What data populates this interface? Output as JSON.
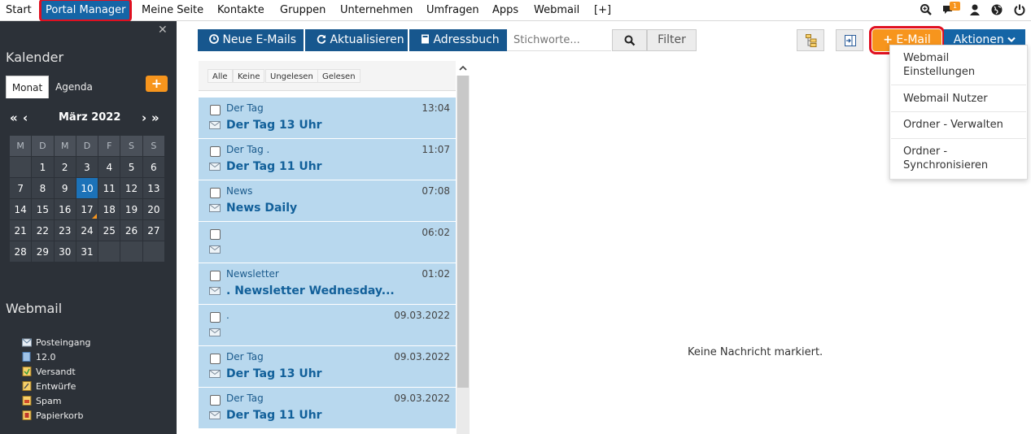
{
  "nav": {
    "items": [
      "Start",
      "Portal Manager",
      "Meine Seite",
      "Kontakte",
      "Gruppen",
      "Unternehmen",
      "Umfragen",
      "Apps",
      "Webmail",
      "[+]"
    ],
    "notification_count": "1",
    "colors": {
      "active": "#1565a6",
      "highlight": "#e01020",
      "badge": "#f7951d"
    }
  },
  "sidebar": {
    "calendar_title": "Kalender",
    "tabs": [
      "Monat",
      "Agenda"
    ],
    "add_icon": "plus-icon",
    "month_label": "März 2022",
    "prev_icons": [
      "double-chevron-left-icon",
      "chevron-left-icon"
    ],
    "next_icons": [
      "chevron-right-icon",
      "double-chevron-right-icon"
    ],
    "weekday_headers": [
      "M",
      "D",
      "M",
      "D",
      "F",
      "S",
      "S"
    ],
    "weeks": [
      [
        "",
        "1",
        "2",
        "3",
        "4",
        "5",
        "6"
      ],
      [
        "7",
        "8",
        "9",
        "10",
        "11",
        "12",
        "13"
      ],
      [
        "14",
        "15",
        "16",
        "17",
        "18",
        "19",
        "20"
      ],
      [
        "21",
        "22",
        "23",
        "24",
        "25",
        "26",
        "27"
      ],
      [
        "28",
        "29",
        "30",
        "31",
        "",
        "",
        ""
      ]
    ],
    "today": "10",
    "event_day": "17",
    "webmail_title": "Webmail",
    "folders": [
      {
        "label": "Posteingang",
        "icon": "inbox-icon"
      },
      {
        "label": "12.0",
        "icon": "folder-icon"
      },
      {
        "label": "Versandt",
        "icon": "sent-folder-icon"
      },
      {
        "label": "Entwürfe",
        "icon": "drafts-folder-icon"
      },
      {
        "label": "Spam",
        "icon": "spam-folder-icon"
      },
      {
        "label": "Papierkorb",
        "icon": "trash-icon"
      }
    ]
  },
  "toolbar": {
    "new_mails": "Neue E-Mails",
    "refresh": "Aktualisieren",
    "address_book": "Adressbuch",
    "search_placeholder": "Stichworte...",
    "filter": "Filter",
    "email": "E-Mail",
    "actions": "Aktionen"
  },
  "dropdown": {
    "items": [
      [
        "Webmail",
        "Einstellungen"
      ],
      [
        "Webmail Nutzer"
      ],
      [
        "Ordner - Verwalten"
      ],
      [
        "Ordner -",
        "Synchronisieren"
      ]
    ]
  },
  "list": {
    "filters": [
      "Alle",
      "Keine",
      "Ungelesen",
      "Gelesen"
    ],
    "mails": [
      {
        "sender": "Der Tag",
        "time": "13:04",
        "subject": "Der Tag 13 Uhr"
      },
      {
        "sender": "Der Tag              .",
        "time": "11:07",
        "subject": "Der Tag 11 Uhr"
      },
      {
        "sender": "         News",
        "time": "07:08",
        "subject": "News Daily"
      },
      {
        "sender": "",
        "time": "06:02",
        "subject": ""
      },
      {
        "sender": "Newsletter",
        "time": "01:02",
        "subject": "              . Newsletter Wednesday..."
      },
      {
        "sender": ".",
        "time": "09.03.2022",
        "subject": ""
      },
      {
        "sender": "Der Tag",
        "time": "09.03.2022",
        "subject": "Der Tag 13 Uhr"
      },
      {
        "sender": "Der Tag",
        "time": "09.03.2022",
        "subject": "Der Tag 11 Uhr"
      }
    ]
  },
  "preview": {
    "empty_message": "Keine Nachricht markiert."
  }
}
